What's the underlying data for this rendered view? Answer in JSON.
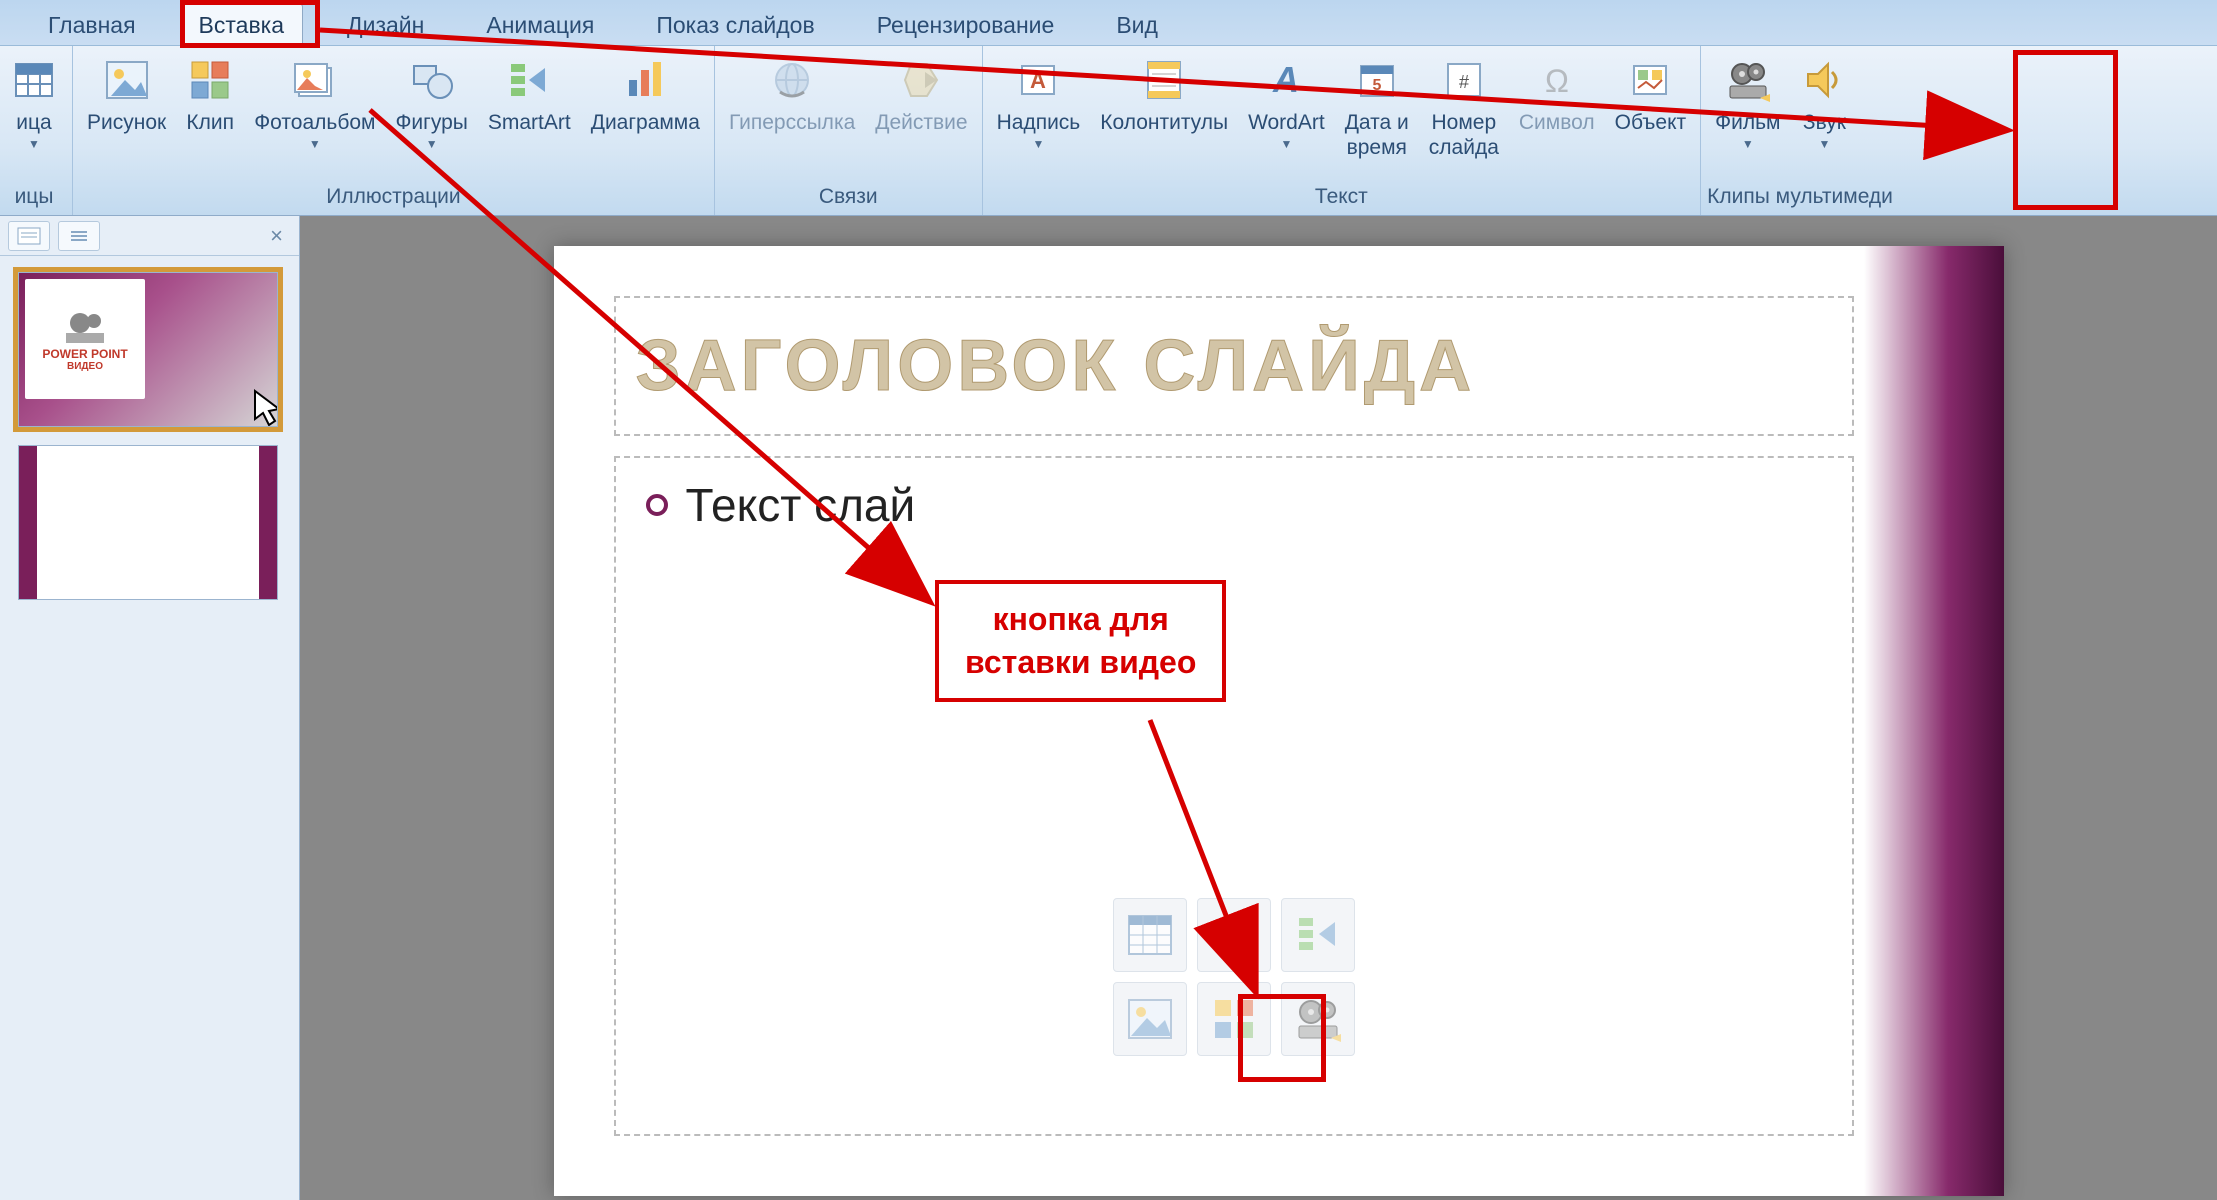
{
  "tabs": {
    "home": "Главная",
    "insert": "Вставка",
    "design": "Дизайн",
    "animation": "Анимация",
    "slideshow": "Показ слайдов",
    "review": "Рецензирование",
    "view": "Вид"
  },
  "ribbon": {
    "table_partial": "ица",
    "picture": "Рисунок",
    "clip": "Клип",
    "photoalbum": "Фотоальбом",
    "shapes": "Фигуры",
    "smartart": "SmartArt",
    "chart": "Диаграмма",
    "hyperlink": "Гиперссылка",
    "action": "Действие",
    "textbox": "Надпись",
    "headerfooter": "Колонтитулы",
    "wordart": "WordArt",
    "datetime": "Дата и\nвремя",
    "slidenum": "Номер\nслайда",
    "symbol": "Символ",
    "object": "Объект",
    "movie": "Фильм",
    "sound": "Звук"
  },
  "groups": {
    "tables_partial": "ицы",
    "illustrations": "Иллюстрации",
    "links": "Связи",
    "text": "Текст",
    "media": "Клипы мультимеди"
  },
  "slide": {
    "title_placeholder": "ЗАГОЛОВОК СЛАЙДА",
    "body_placeholder": "Текст слай"
  },
  "thumb1": {
    "line1": "POWER POINT",
    "line2": "ВИДЕО"
  },
  "annotation": {
    "label_line1": "кнопка для",
    "label_line2": "вставки видео"
  },
  "colors": {
    "annotation": "#d60000",
    "theme_purple": "#7a1f5a"
  }
}
